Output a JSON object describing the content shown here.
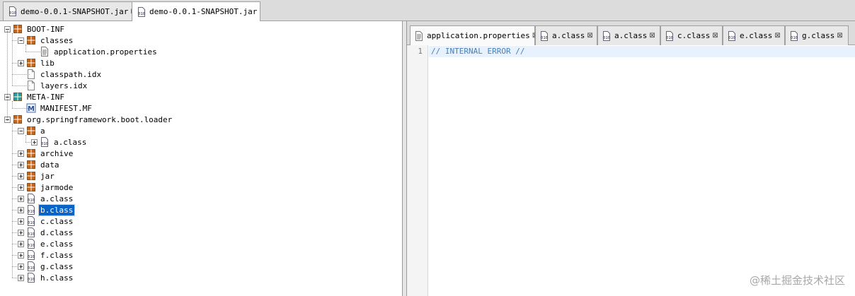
{
  "file_tabs": [
    {
      "label": "demo-0.0.1-SNAPSHOT.jar",
      "active": false
    },
    {
      "label": "demo-0.0.1-SNAPSHOT.jar",
      "active": true
    }
  ],
  "tree": [
    {
      "label": "BOOT-INF",
      "icon": "package-icon",
      "depth": 0,
      "expander": "minus"
    },
    {
      "label": "classes",
      "icon": "package-icon",
      "depth": 1,
      "expander": "minus"
    },
    {
      "label": "application.properties",
      "icon": "text-file-icon",
      "depth": 2,
      "expander": "none"
    },
    {
      "label": "lib",
      "icon": "package-icon",
      "depth": 1,
      "expander": "plus"
    },
    {
      "label": "classpath.idx",
      "icon": "blank-file-icon",
      "depth": 1,
      "expander": "none"
    },
    {
      "label": "layers.idx",
      "icon": "blank-file-icon",
      "depth": 1,
      "expander": "none"
    },
    {
      "label": "META-INF",
      "icon": "package-teal-icon",
      "depth": 0,
      "expander": "minus"
    },
    {
      "label": "MANIFEST.MF",
      "icon": "manifest-icon",
      "depth": 1,
      "expander": "none"
    },
    {
      "label": "org.springframework.boot.loader",
      "icon": "package-icon",
      "depth": 0,
      "expander": "minus"
    },
    {
      "label": "a",
      "icon": "package-icon",
      "depth": 1,
      "expander": "minus"
    },
    {
      "label": "a.class",
      "icon": "class-file-icon",
      "depth": 2,
      "expander": "plus"
    },
    {
      "label": "archive",
      "icon": "package-icon",
      "depth": 1,
      "expander": "plus"
    },
    {
      "label": "data",
      "icon": "package-icon",
      "depth": 1,
      "expander": "plus"
    },
    {
      "label": "jar",
      "icon": "package-icon",
      "depth": 1,
      "expander": "plus"
    },
    {
      "label": "jarmode",
      "icon": "package-icon",
      "depth": 1,
      "expander": "plus"
    },
    {
      "label": "a.class",
      "icon": "class-file-icon",
      "depth": 1,
      "expander": "plus"
    },
    {
      "label": "b.class",
      "icon": "class-file-icon",
      "depth": 1,
      "expander": "plus",
      "selected": true
    },
    {
      "label": "c.class",
      "icon": "class-file-icon",
      "depth": 1,
      "expander": "plus"
    },
    {
      "label": "d.class",
      "icon": "class-file-icon",
      "depth": 1,
      "expander": "plus"
    },
    {
      "label": "e.class",
      "icon": "class-file-icon",
      "depth": 1,
      "expander": "plus"
    },
    {
      "label": "f.class",
      "icon": "class-file-icon",
      "depth": 1,
      "expander": "plus"
    },
    {
      "label": "g.class",
      "icon": "class-file-icon",
      "depth": 1,
      "expander": "plus"
    },
    {
      "label": "h.class",
      "icon": "class-file-icon",
      "depth": 1,
      "expander": "plus"
    }
  ],
  "editor_tabs": [
    {
      "label": "application.properties",
      "icon": "text-file-icon",
      "active": true
    },
    {
      "label": "a.class",
      "icon": "class-file-icon",
      "active": false
    },
    {
      "label": "a.class",
      "icon": "class-file-icon",
      "active": false
    },
    {
      "label": "c.class",
      "icon": "class-file-icon",
      "active": false
    },
    {
      "label": "e.class",
      "icon": "class-file-icon",
      "active": false
    },
    {
      "label": "g.class",
      "icon": "class-file-icon",
      "active": false
    }
  ],
  "editor": {
    "line_number": "1",
    "code": "// INTERNAL ERROR //"
  },
  "watermark": "@稀土掘金技术社区",
  "colors": {
    "selection": "#0a64c8",
    "package": "#c86414",
    "package_teal": "#2a9c9c",
    "comment": "#4a7fb5",
    "current_line": "#e8f2fe"
  }
}
